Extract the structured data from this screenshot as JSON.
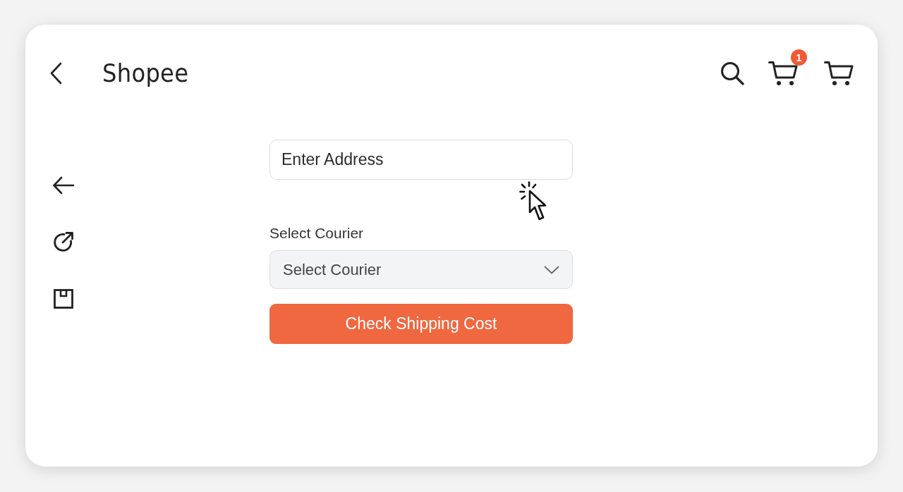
{
  "header": {
    "title": "Shopee",
    "cart_badge": "1"
  },
  "address_field": {
    "placeholder": "Enter Address"
  },
  "courier": {
    "label": "Select Courier",
    "placeholder": "Select Courier"
  },
  "submit_button": {
    "label": "Check Shipping Cost"
  }
}
